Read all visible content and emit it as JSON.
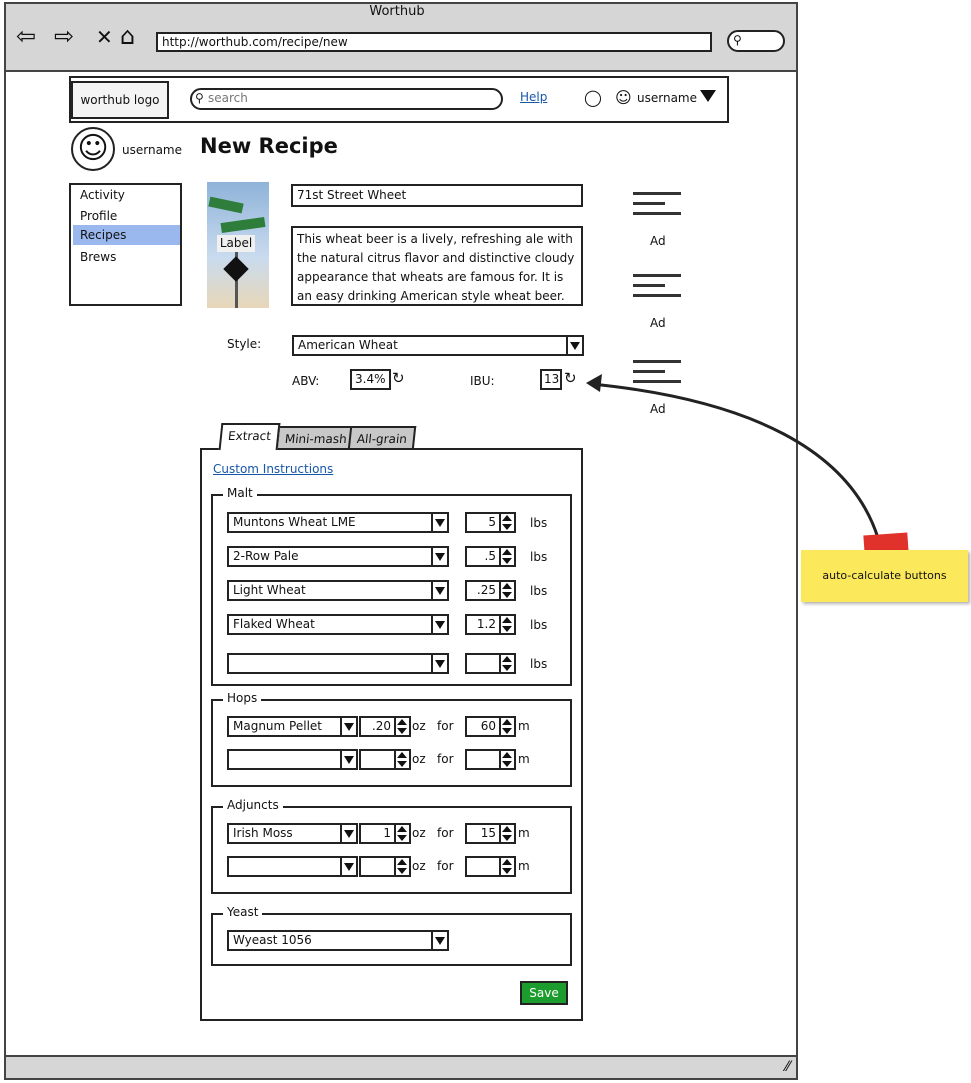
{
  "browser": {
    "title": "Worthub",
    "url": "http://worthub.com/recipe/new"
  },
  "header": {
    "logo_text": "worthub logo",
    "search_placeholder": "search",
    "help_label": "Help",
    "username": "username"
  },
  "profile": {
    "username": "username"
  },
  "page_title": "New Recipe",
  "sidebar": {
    "items": [
      {
        "label": "Activity",
        "selected": false
      },
      {
        "label": "Profile",
        "selected": false
      },
      {
        "label": "Recipes",
        "selected": true
      },
      {
        "label": "Brews",
        "selected": false
      }
    ]
  },
  "recipe": {
    "label_text": "Label",
    "name": "71st Street Wheet",
    "description": "This wheat beer is a lively, refreshing ale with the natural citrus flavor and distinctive cloudy appearance that wheats are famous for. It is an easy drinking American style wheat beer.",
    "style_label": "Style:",
    "style": "American Wheat",
    "abv_label": "ABV:",
    "abv": "3.4%",
    "ibu_label": "IBU:",
    "ibu": "13"
  },
  "ads": [
    "Ad",
    "Ad",
    "Ad"
  ],
  "tabs": [
    "Extract",
    "Mini-mash",
    "All-grain"
  ],
  "custom_instructions": "Custom Instructions",
  "malt": {
    "title": "Malt",
    "unit": "lbs",
    "rows": [
      {
        "name": "Muntons Wheat LME",
        "amount": "5"
      },
      {
        "name": "2-Row Pale",
        "amount": ".5"
      },
      {
        "name": "Light Wheat",
        "amount": ".25"
      },
      {
        "name": "Flaked Wheat",
        "amount": "1.2"
      },
      {
        "name": "",
        "amount": ""
      }
    ]
  },
  "hops": {
    "title": "Hops",
    "unit": "oz",
    "for_label": "for",
    "time_unit": "m",
    "rows": [
      {
        "name": "Magnum Pellet",
        "amount": ".20",
        "time": "60"
      },
      {
        "name": "",
        "amount": "",
        "time": ""
      }
    ]
  },
  "adjuncts": {
    "title": "Adjuncts",
    "unit": "oz",
    "for_label": "for",
    "time_unit": "m",
    "rows": [
      {
        "name": "Irish Moss",
        "amount": "1",
        "time": "15"
      },
      {
        "name": "",
        "amount": "",
        "time": ""
      }
    ]
  },
  "yeast": {
    "title": "Yeast",
    "value": "Wyeast 1056"
  },
  "save_label": "Save",
  "annotation": {
    "note_text": "auto-calculate buttons"
  },
  "colors": {
    "selected_nav": "#9ab8ee",
    "save_button": "#1d9c2e",
    "note": "#fbe85b",
    "link": "#1856a8"
  }
}
